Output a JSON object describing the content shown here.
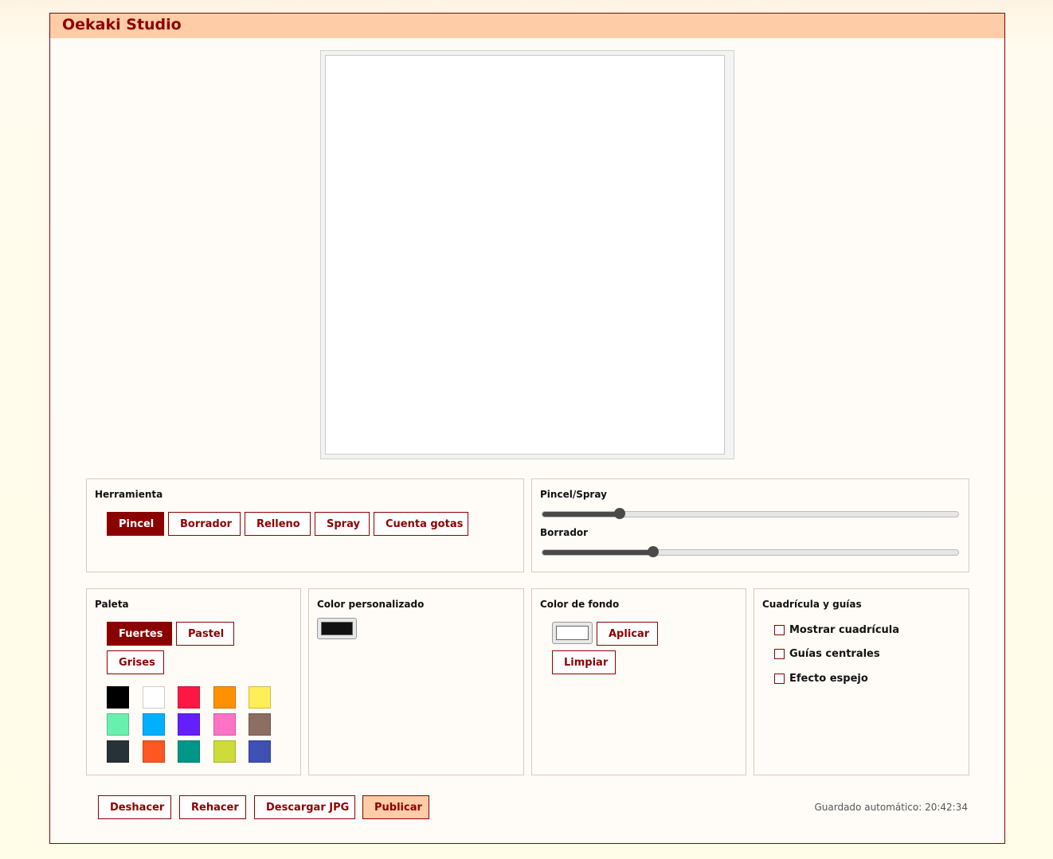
{
  "app": {
    "title": "Oekaki Studio"
  },
  "tools": {
    "title": "Herramienta",
    "items": [
      "Pincel",
      "Borrador",
      "Relleno",
      "Spray",
      "Cuenta gotas"
    ],
    "active": "Pincel"
  },
  "sizes": {
    "brush_label": "Pincel/Spray",
    "brush_percent": 18.5,
    "eraser_label": "Borrador",
    "eraser_percent": 26.7
  },
  "palette": {
    "title": "Paleta",
    "sets": [
      "Fuertes",
      "Pastel",
      "Grises"
    ],
    "active": "Fuertes",
    "colors": [
      "#000000",
      "#ffffff",
      "#ff1744",
      "#ff9100",
      "#ffee58",
      "#69f0ae",
      "#00b0ff",
      "#651fff",
      "#ff73c6",
      "#8d6e63",
      "#263238",
      "#ff5722",
      "#009688",
      "#cddc39",
      "#3f51b5"
    ]
  },
  "custom": {
    "title": "Color personalizado",
    "color": "#111111"
  },
  "background": {
    "title": "Color de fondo",
    "color": "#ffffff",
    "apply": "Aplicar",
    "clear": "Limpiar"
  },
  "grid": {
    "title": "Cuadrícula y guías",
    "options": [
      "Mostrar cuadrícula",
      "Guías centrales",
      "Efecto espejo"
    ]
  },
  "actions": {
    "undo": "Deshacer",
    "redo": "Rehacer",
    "download": "Descargar JPG",
    "publish": "Publicar"
  },
  "status": "Guardado automático: 20:42:34"
}
